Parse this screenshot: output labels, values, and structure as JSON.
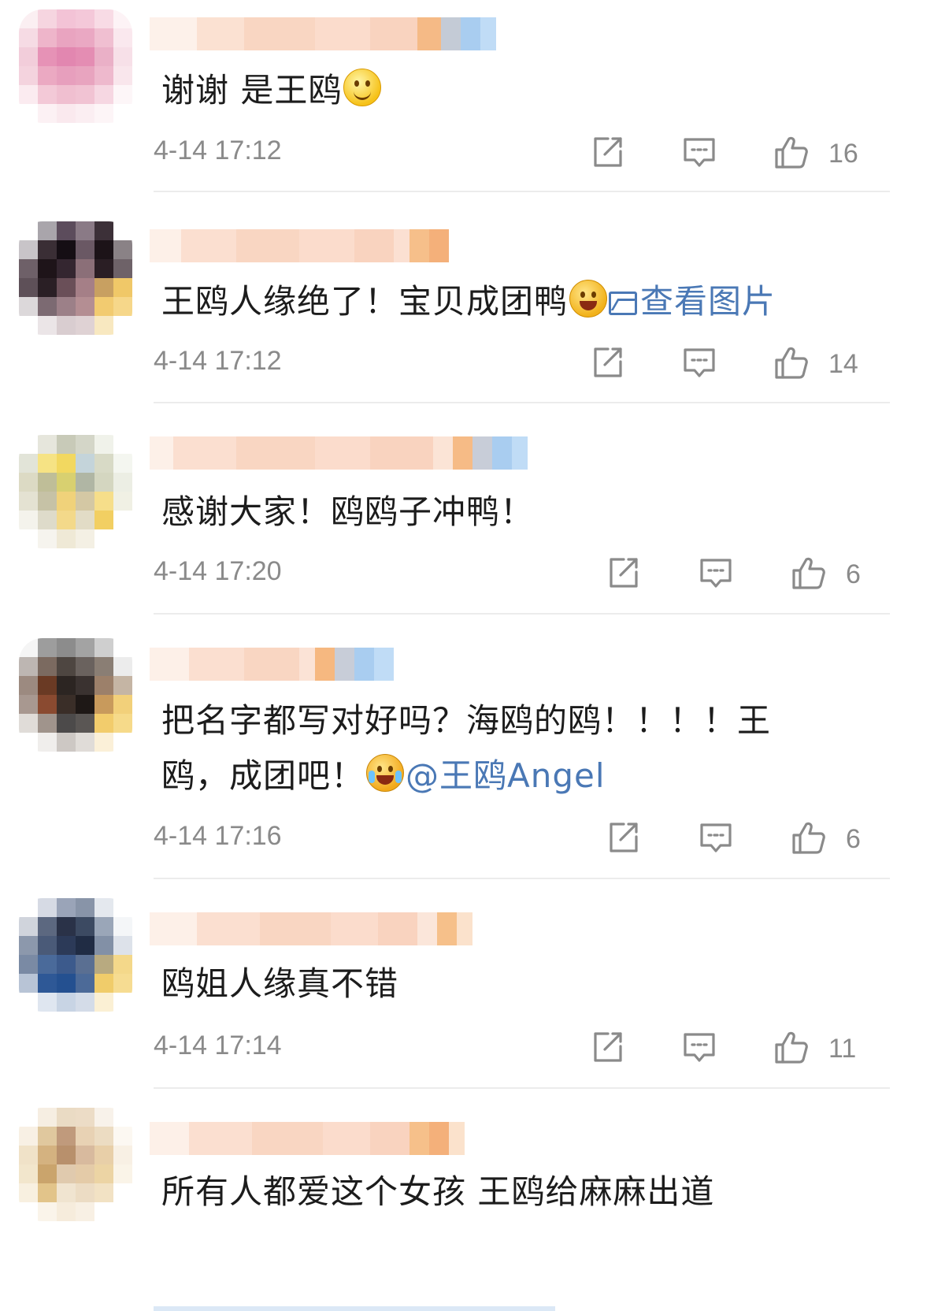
{
  "comments": [
    {
      "text": "谢谢 是王鸥",
      "emoji": "smile-emoji",
      "time": "4-14 17:12",
      "likes": "16"
    },
    {
      "text": "王鸥人缘绝了！宝贝成团鸭",
      "emoji": "grin-emoji",
      "link": "查看图片",
      "time": "4-14 17:12",
      "likes": "14"
    },
    {
      "text": "感谢大家！鸥鸥子冲鸭！",
      "time": "4-14 17:20",
      "likes": "6"
    },
    {
      "text_line1": "把名字都写对好吗？海鸥的鸥！！！！王",
      "text_line2": "鸥，成团吧！",
      "emoji": "cry-emoji",
      "mention": "@王鸥Angel",
      "time": "4-14 17:16",
      "likes": "6"
    },
    {
      "text": "鸥姐人缘真不错",
      "time": "4-14 17:14",
      "likes": "11"
    },
    {
      "text": "所有人都爱这个女孩 王鸥给麻麻出道"
    }
  ],
  "colors": {
    "link": "#4a78b5",
    "meta": "#8a8a8a",
    "text": "#1c1c1c"
  },
  "icons": [
    "share-icon",
    "comment-icon",
    "like-icon"
  ]
}
